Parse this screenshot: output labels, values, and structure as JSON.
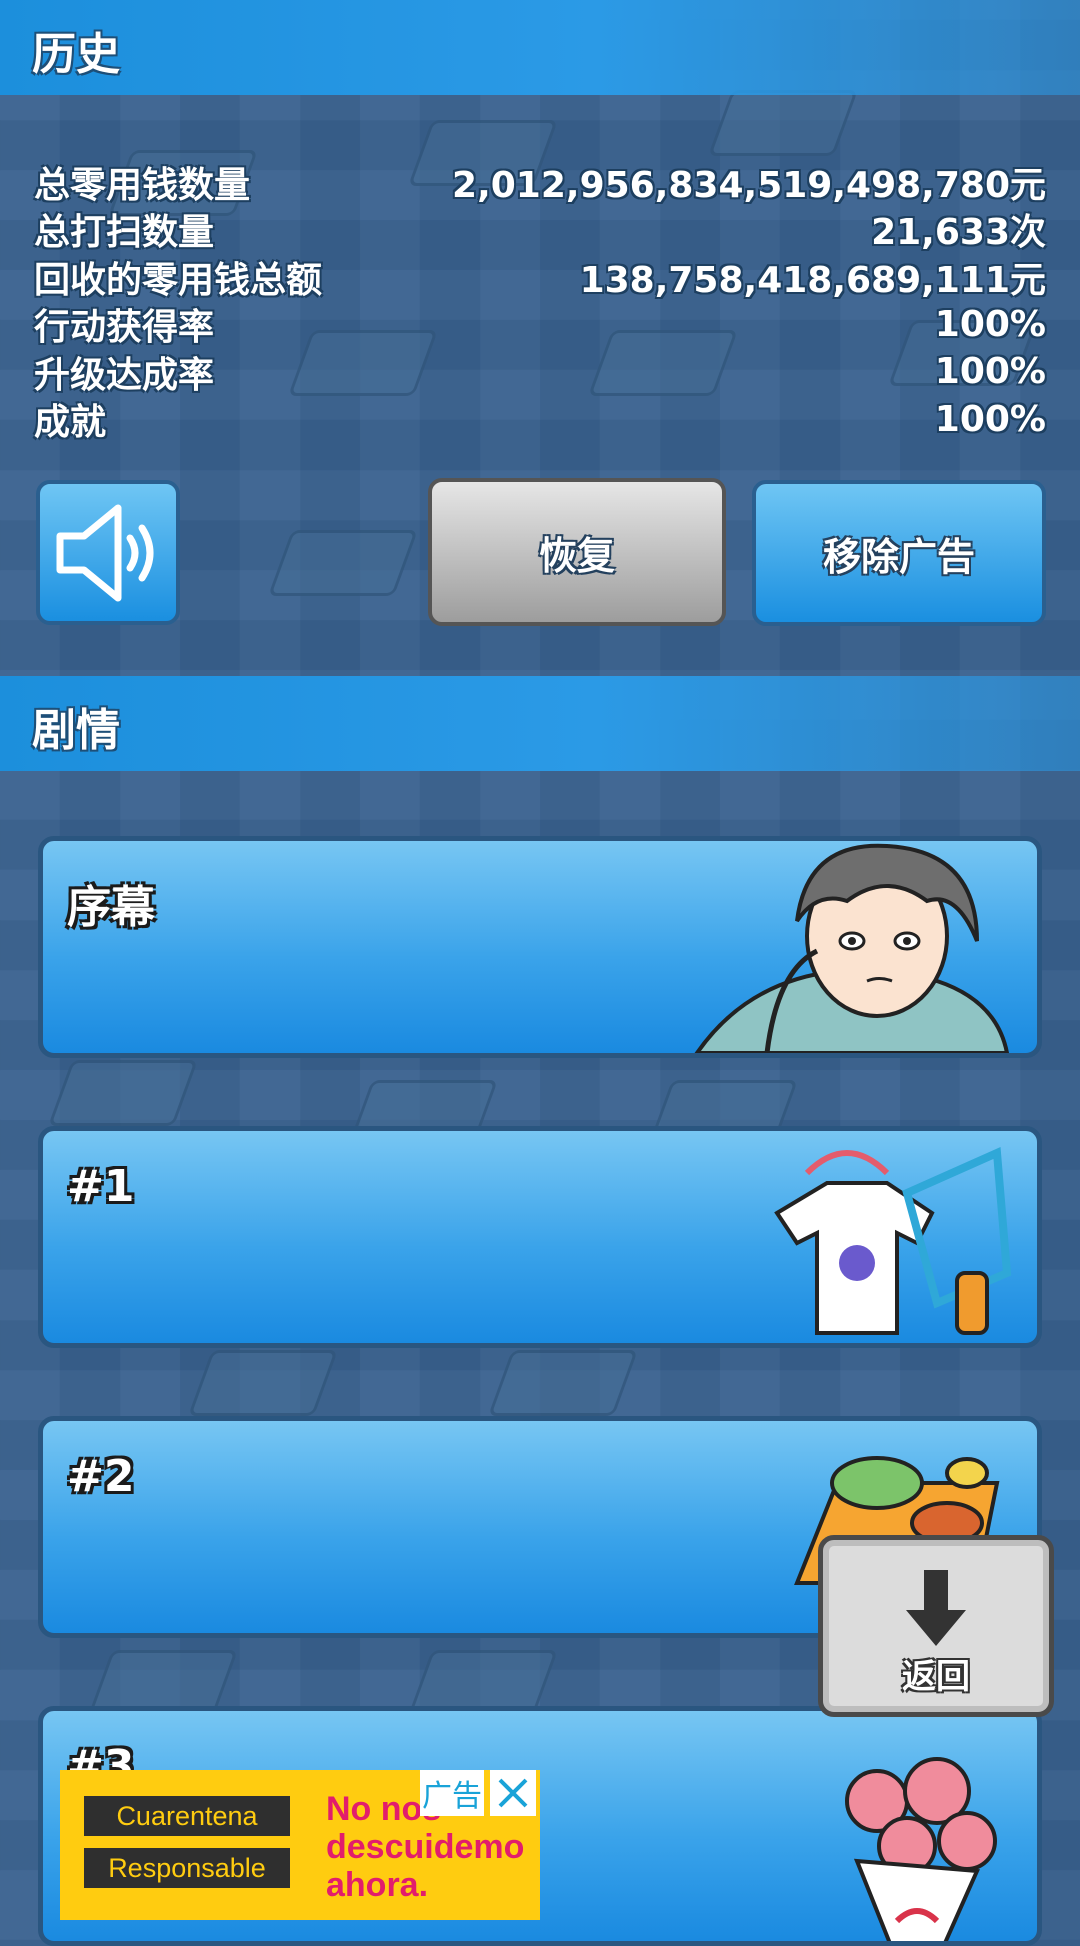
{
  "history": {
    "title": "历史",
    "stats": [
      {
        "label": "总零用钱数量",
        "value": "2,012,956,834,519,498,780元"
      },
      {
        "label": "总打扫数量",
        "value": "21,633次"
      },
      {
        "label": "回收的零用钱总额",
        "value": "138,758,418,689,111元"
      },
      {
        "label": "行动获得率",
        "value": "100%"
      },
      {
        "label": "升级达成率",
        "value": "100%"
      },
      {
        "label": "成就",
        "value": "100%"
      }
    ]
  },
  "buttons": {
    "sound_icon": "speaker-icon",
    "restore": "恢复",
    "remove_ads": "移除广告"
  },
  "story": {
    "title": "剧情",
    "chapters": [
      {
        "label": "序幕",
        "icon": "character-portrait-icon"
      },
      {
        "label": "#1",
        "icon": "laundry-icon"
      },
      {
        "label": "#2",
        "icon": "meal-tray-icon"
      },
      {
        "label": "#3",
        "icon": "flower-bouquet-icon"
      }
    ]
  },
  "back_button": {
    "label": "返回",
    "icon": "arrow-down-icon"
  },
  "ad": {
    "line1": "Cuarentena",
    "line2": "Responsable",
    "slogan": "No nos\ndescuidemo\nahora.",
    "ad_label": "广告",
    "close_icon": "close-icon"
  },
  "colors": {
    "header": "#1c8fdc",
    "background": "#3a6290",
    "card": "#3aa3ea",
    "ad_bg": "#ffcc10",
    "ad_text": "#e21d6c"
  }
}
